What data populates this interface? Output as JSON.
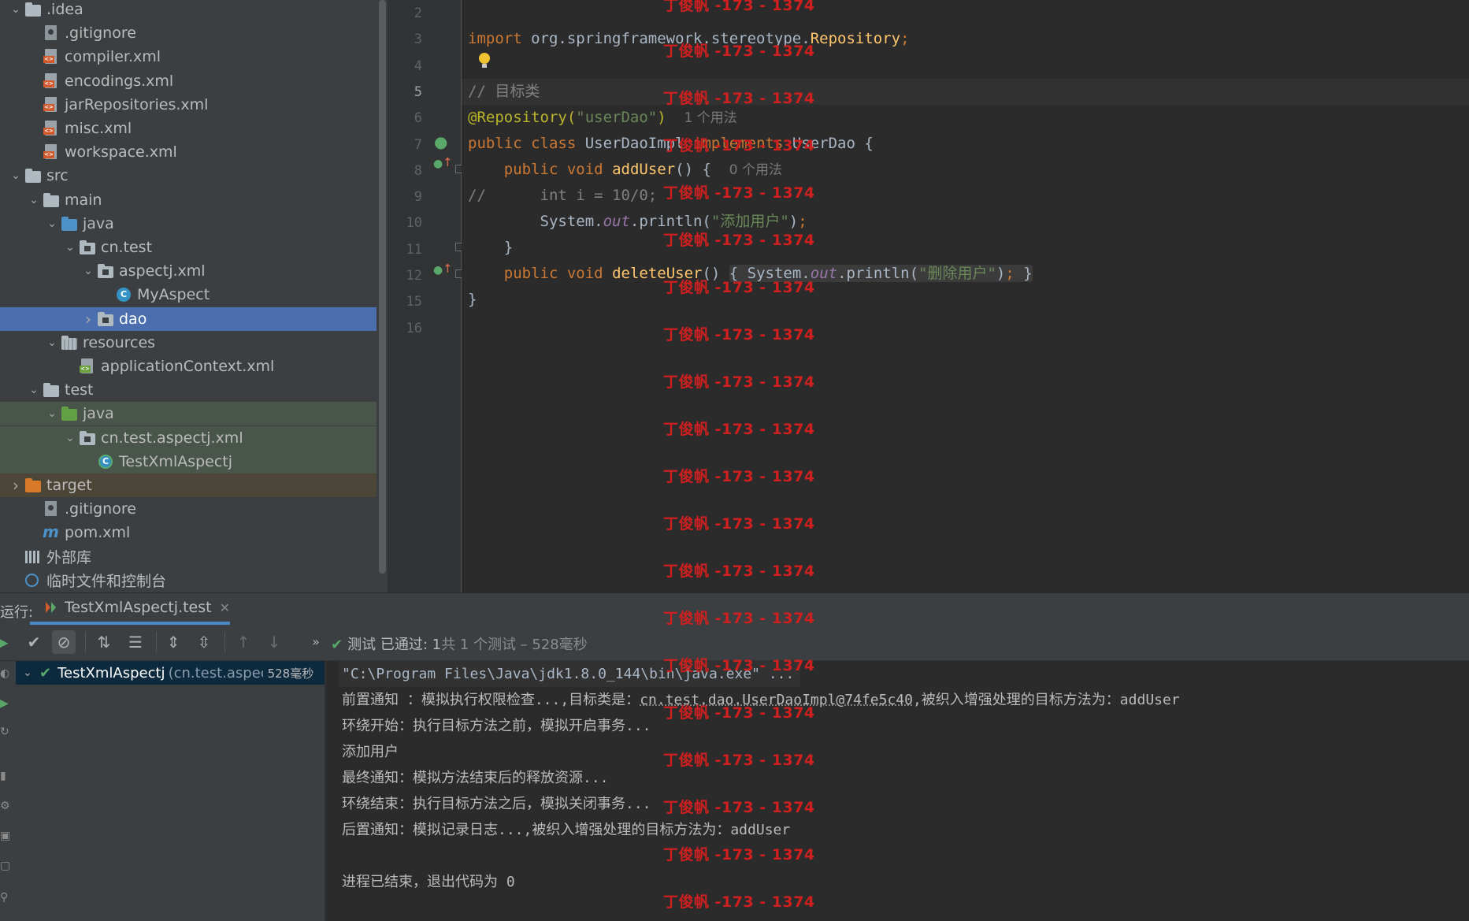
{
  "project_tree": [
    {
      "label": ".idea",
      "icon": "folder-icon",
      "expanded": true
    },
    {
      "label": ".gitignore",
      "icon": "gitignore-file-icon"
    },
    {
      "label": "compiler.xml",
      "icon": "xml-file-icon"
    },
    {
      "label": "encodings.xml",
      "icon": "xml-file-icon"
    },
    {
      "label": "jarRepositories.xml",
      "icon": "xml-file-icon"
    },
    {
      "label": "misc.xml",
      "icon": "xml-file-icon"
    },
    {
      "label": "workspace.xml",
      "icon": "xml-file-icon"
    },
    {
      "label": "src",
      "icon": "folder-icon",
      "expanded": true
    },
    {
      "label": "main",
      "icon": "folder-icon",
      "expanded": true
    },
    {
      "label": "java",
      "icon": "source-folder-icon",
      "expanded": true
    },
    {
      "label": "cn.test",
      "icon": "package-icon",
      "expanded": true
    },
    {
      "label": "aspectj.xml",
      "icon": "package-icon",
      "expanded": true
    },
    {
      "label": "MyAspect",
      "icon": "class-icon"
    },
    {
      "label": "dao",
      "icon": "package-icon",
      "expanded": false,
      "selected": true
    },
    {
      "label": "resources",
      "icon": "resources-folder-icon",
      "expanded": true
    },
    {
      "label": "applicationContext.xml",
      "icon": "spring-xml-icon"
    },
    {
      "label": "test",
      "icon": "folder-icon",
      "expanded": true
    },
    {
      "label": "java",
      "icon": "test-source-folder-icon",
      "expanded": true
    },
    {
      "label": "cn.test.aspectj.xml",
      "icon": "package-icon",
      "expanded": true
    },
    {
      "label": "TestXmlAspectj",
      "icon": "test-class-icon"
    },
    {
      "label": "target",
      "icon": "excluded-folder-icon",
      "expanded": false
    },
    {
      "label": ".gitignore",
      "icon": "gitignore-file-icon"
    },
    {
      "label": "pom.xml",
      "icon": "maven-icon"
    },
    {
      "label": "外部库",
      "icon": "libraries-icon"
    },
    {
      "label": "临时文件和控制台",
      "icon": "scratches-icon"
    }
  ],
  "editor": {
    "line_numbers": [
      "2",
      "3",
      "4",
      "5",
      "6",
      "7",
      "8",
      "9",
      "10",
      "11",
      "12",
      "15",
      "16"
    ],
    "current_line": "5",
    "code": {
      "l3_import": "import",
      "l3_pkg": " org.springframework.stereotype.",
      "l3_cls": "Repository",
      "l3_semi": ";",
      "l5_comment": "// 目标类",
      "l6_ann": "@Repository(",
      "l6_str": "\"userDao\"",
      "l6_close": ")",
      "l6_hint": "1 个用法",
      "l7_kw1": "public class",
      "l7_name": " UserDaoImpl ",
      "l7_kw2": "implements",
      "l7_rest": " UserDao {",
      "l8_kw": "public void",
      "l8_fn": "addUser",
      "l8_rest": "() {",
      "l8_hint": "0 个用法",
      "l9_comment": "//      int i = 10/0;",
      "l10_a": "System.",
      "l10_fld": "out",
      "l10_b": ".println(",
      "l10_str": "\"添加用户\"",
      "l10_c": ")",
      "l10_semi": ";",
      "l11": "}",
      "l12_kw": "public void",
      "l12_fn": "deleteUser",
      "l12_a": "() ",
      "l12_fold_open": "{",
      "l12_b": " System.",
      "l12_fld": "out",
      "l12_c": ".println(",
      "l12_str": "\"删除用户\"",
      "l12_d": ")",
      "l12_semi": ";",
      "l12_fold_close": " }",
      "l15": "}"
    }
  },
  "run_window": {
    "label": "运行:",
    "tab": "TestXmlAspectj.test",
    "status_pass": "测试 已通过: ",
    "status_count": "1",
    "status_rest": "共 1 个测试 – 528毫秒",
    "test_name": "TestXmlAspectj",
    "test_pkg": "(cn.test.aspectj",
    "test_time": "528毫秒",
    "console": [
      "\"C:\\Program Files\\Java\\jdk1.8.0_144\\bin\\java.exe\" ...",
      "前置通知 ：模拟执行权限检查...,目标类是：",
      "cn.test.dao.UserDaoImpl@74fe5c40",
      ",被织入增强处理的目标方法为：addUser",
      "环绕开始：执行目标方法之前，模拟开启事务...",
      "添加用户",
      "最终通知：模拟方法结束后的释放资源...",
      "环绕结束：执行目标方法之后，模拟关闭事务...",
      "后置通知：模拟记录日志...,被织入增强处理的目标方法为：addUser",
      "",
      "进程已结束，退出代码为 0"
    ]
  },
  "watermark": {
    "text": "丁俊帆 -173 - 1374",
    "color": "#d01f1f"
  },
  "colors": {
    "tree_bg": "#3c3f41",
    "editor_bg": "#2b2b2b",
    "selection": "#4b6eaf",
    "keyword": "#cc7832",
    "string": "#6a8759",
    "annotation": "#bbb529",
    "function": "#ffc66d",
    "pass": "#59a869"
  }
}
